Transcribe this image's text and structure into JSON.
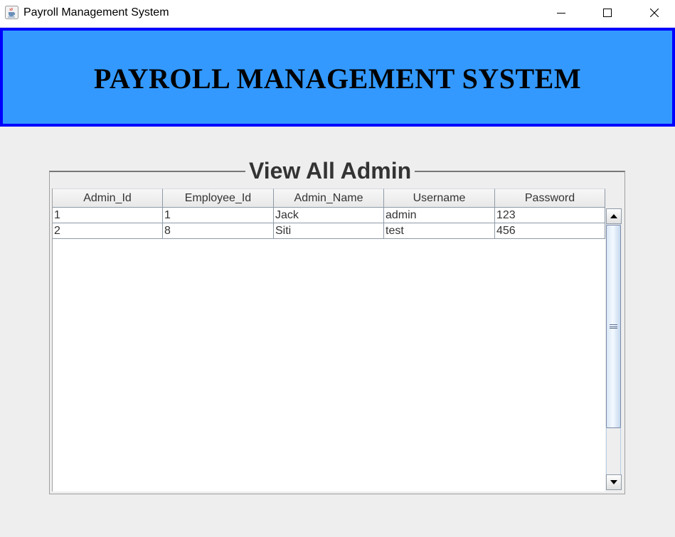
{
  "window": {
    "title": "Payroll Management System",
    "icons": {
      "app": "java-cup-icon",
      "minimize": "minimize-icon",
      "maximize": "maximize-icon",
      "close": "close-icon"
    }
  },
  "banner": {
    "title": "PAYROLL MANAGEMENT SYSTEM",
    "colors": {
      "background": "#3399ff",
      "border": "#0000ff"
    }
  },
  "panel": {
    "title": "View All Admin"
  },
  "table": {
    "columns": [
      "Admin_Id",
      "Employee_Id",
      "Admin_Name",
      "Username",
      "Password"
    ],
    "rows": [
      [
        "1",
        "1",
        "Jack",
        "admin",
        "123"
      ],
      [
        "2",
        "8",
        "Siti",
        "test",
        "456"
      ]
    ]
  },
  "scrollbar": {
    "icons": {
      "up": "arrow-up-icon",
      "down": "arrow-down-icon",
      "grip": "grip-icon"
    }
  }
}
